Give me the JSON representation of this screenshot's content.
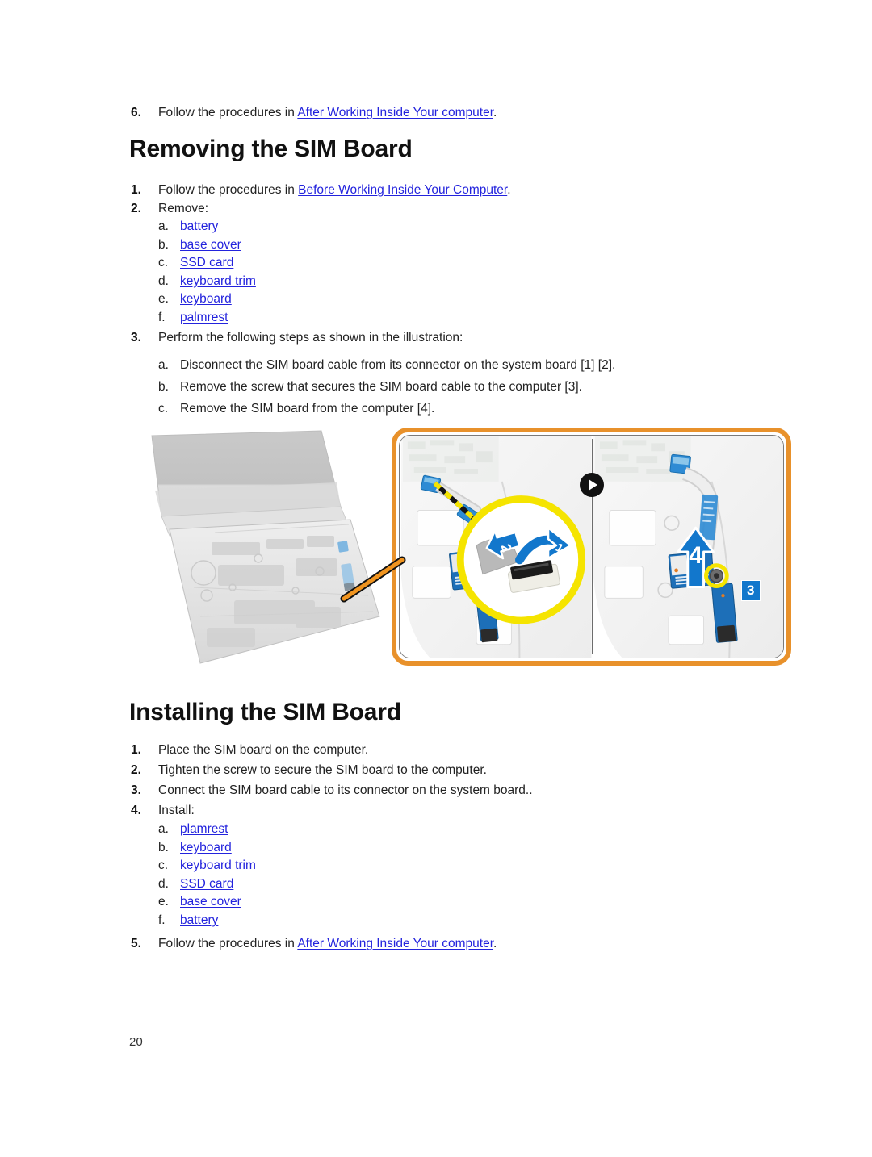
{
  "page": {
    "number": "20"
  },
  "top_step": {
    "num": "6.",
    "prefix": "Follow the procedures in ",
    "link": "After Working Inside Your computer",
    "suffix": "."
  },
  "removing": {
    "heading": "Removing the SIM Board",
    "steps": [
      {
        "num": "1.",
        "prefix": "Follow the procedures in ",
        "link": "Before Working Inside Your Computer",
        "suffix": "."
      },
      {
        "num": "2.",
        "prefix": "Remove:",
        "link": "",
        "suffix": ""
      }
    ],
    "remove_items": [
      {
        "marker": "a.",
        "label": "battery"
      },
      {
        "marker": "b.",
        "label": "base cover"
      },
      {
        "marker": "c.",
        "label": "SSD card"
      },
      {
        "marker": "d.",
        "label": "keyboard trim"
      },
      {
        "marker": "e.",
        "label": "keyboard"
      },
      {
        "marker": "f.",
        "label": "palmrest"
      }
    ],
    "step3": {
      "num": "3.",
      "text": "Perform the following steps as shown in the illustration:"
    },
    "step3_items": [
      {
        "marker": "a.",
        "text": "Disconnect the SIM board cable from its connector on the system board [1] [2]."
      },
      {
        "marker": "b.",
        "text": "Remove the screw that secures the SIM board cable to the computer [3]."
      },
      {
        "marker": "c.",
        "text": "Remove the SIM board from the computer [4]."
      }
    ]
  },
  "installing": {
    "heading": "Installing the SIM Board",
    "steps": [
      {
        "num": "1.",
        "text": "Place the SIM board on the computer."
      },
      {
        "num": "2.",
        "text": "Tighten the screw to secure the SIM board to the computer."
      },
      {
        "num": "3.",
        "text": "Connect the SIM board cable to its connector on the system board.."
      },
      {
        "num": "4.",
        "text": "Install:"
      }
    ],
    "install_items": [
      {
        "marker": "a.",
        "label": "plamrest"
      },
      {
        "marker": "b.",
        "label": "keyboard"
      },
      {
        "marker": "c.",
        "label": "keyboard trim"
      },
      {
        "marker": "d.",
        "label": "SSD card"
      },
      {
        "marker": "e.",
        "label": "base cover"
      },
      {
        "marker": "f.",
        "label": "battery"
      }
    ],
    "final_step": {
      "num": "5.",
      "prefix": "Follow the procedures in ",
      "link": "After Working Inside Your computer",
      "suffix": "."
    }
  },
  "illustration": {
    "callouts": {
      "one": "1",
      "two": "2",
      "three": "3",
      "four": "4"
    },
    "colors": {
      "frame": "#e8912b",
      "callout": "#1277cc",
      "highlight": "#f5e400",
      "board": "#1d6fb8",
      "link": "#2323dd"
    }
  }
}
